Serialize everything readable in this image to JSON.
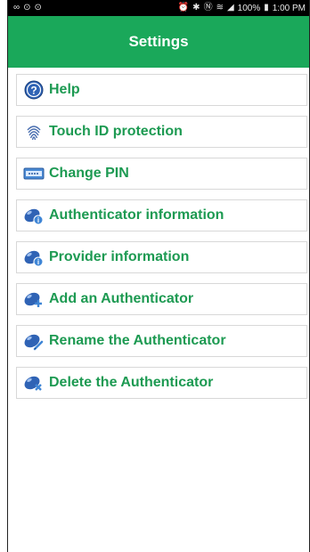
{
  "status_bar": {
    "left_icons": [
      "voicemail-icon",
      "shield-icon",
      "shield-icon"
    ],
    "right_icons": [
      "alarm-icon",
      "bluetooth-icon",
      "nfc-icon",
      "wifi-icon",
      "signal-icon"
    ],
    "battery": "100%",
    "time": "1:00 PM"
  },
  "app_bar": {
    "title": "Settings"
  },
  "menu": {
    "items": [
      {
        "label": "Help",
        "icon": "help-icon"
      },
      {
        "label": "Touch ID protection",
        "icon": "fingerprint-icon"
      },
      {
        "label": "Change PIN",
        "icon": "pin-keypad-icon"
      },
      {
        "label": "Authenticator information",
        "icon": "authenticator-info-icon"
      },
      {
        "label": "Provider information",
        "icon": "provider-info-icon"
      },
      {
        "label": "Add an Authenticator",
        "icon": "add-authenticator-icon"
      },
      {
        "label": "Rename the Authenticator",
        "icon": "rename-authenticator-icon"
      },
      {
        "label": "Delete the Authenticator",
        "icon": "delete-authenticator-icon"
      }
    ]
  },
  "colors": {
    "accent": "#1aa85a",
    "label": "#1d9a52",
    "icon_blue": "#2f63b5"
  }
}
